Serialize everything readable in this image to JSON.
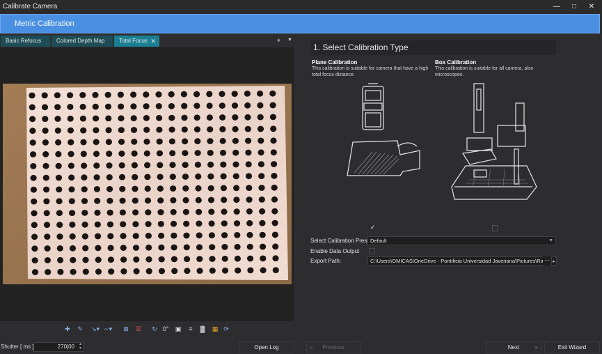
{
  "window": {
    "title": "Calibrate Camera"
  },
  "header": {
    "title": "Metric Calibration"
  },
  "tabs": [
    {
      "label": "Basic Refocus"
    },
    {
      "label": "Colored Depth Map"
    },
    {
      "label": "Total Focus"
    }
  ],
  "viewer_tools": {
    "rotate_value": "0°"
  },
  "bottom": {
    "shutter_label": "Shutter [ ms ]",
    "shutter_value": "270|00",
    "open_log": "Open Log",
    "previous": "Previous",
    "next": "Next",
    "exit": "Exit Wizard"
  },
  "step": {
    "title": "1. Select Calibration Type",
    "options": [
      {
        "title": "Plane Calibration",
        "desc": "This calibration is suitable for camera that have a high total focus distance.",
        "checked": true
      },
      {
        "title": "Box Calibration",
        "desc": "This calibration is suitable for all camera, also microscopes.",
        "checked": false
      }
    ]
  },
  "form": {
    "preset_label": "Select Calibration Preset:",
    "preset_value": "Default",
    "data_output_label": "Enable Data Output",
    "export_label": "Export Path:",
    "export_value": "C:\\Users\\OMICAS\\OneDrive - Pontificia Universidad Javeriana\\Pictures\\Raytri",
    "export_more": "···"
  },
  "colors": {
    "accent": "#4a90e2",
    "tab_active": "#1a7f92",
    "tab": "#1e4d57"
  }
}
